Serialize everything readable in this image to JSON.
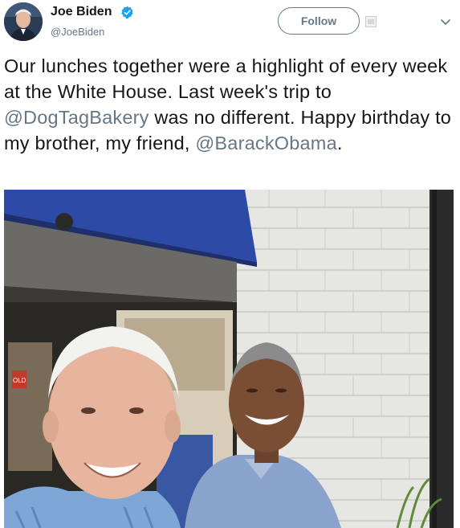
{
  "author": {
    "display_name": "Joe Biden",
    "handle": "@JoeBiden",
    "verified": true,
    "avatar_icon": "profile-photo"
  },
  "actions": {
    "follow_label": "Follow"
  },
  "tweet": {
    "text_part1": "Our lunches together were a highlight of every week at the White House. Last week's trip to ",
    "mention1": "@DogTagBakery",
    "text_part2": " was no different. Happy birthday to my brother, my friend, ",
    "mention2": "@BarackObama",
    "text_part3": "."
  },
  "photo": {
    "awning_sign": "OLD"
  },
  "colors": {
    "mention": "#657786",
    "text": "#14171a",
    "verified": "#1da1f2",
    "awning": "#2c4aa6",
    "brick": "#e9e9e6"
  }
}
